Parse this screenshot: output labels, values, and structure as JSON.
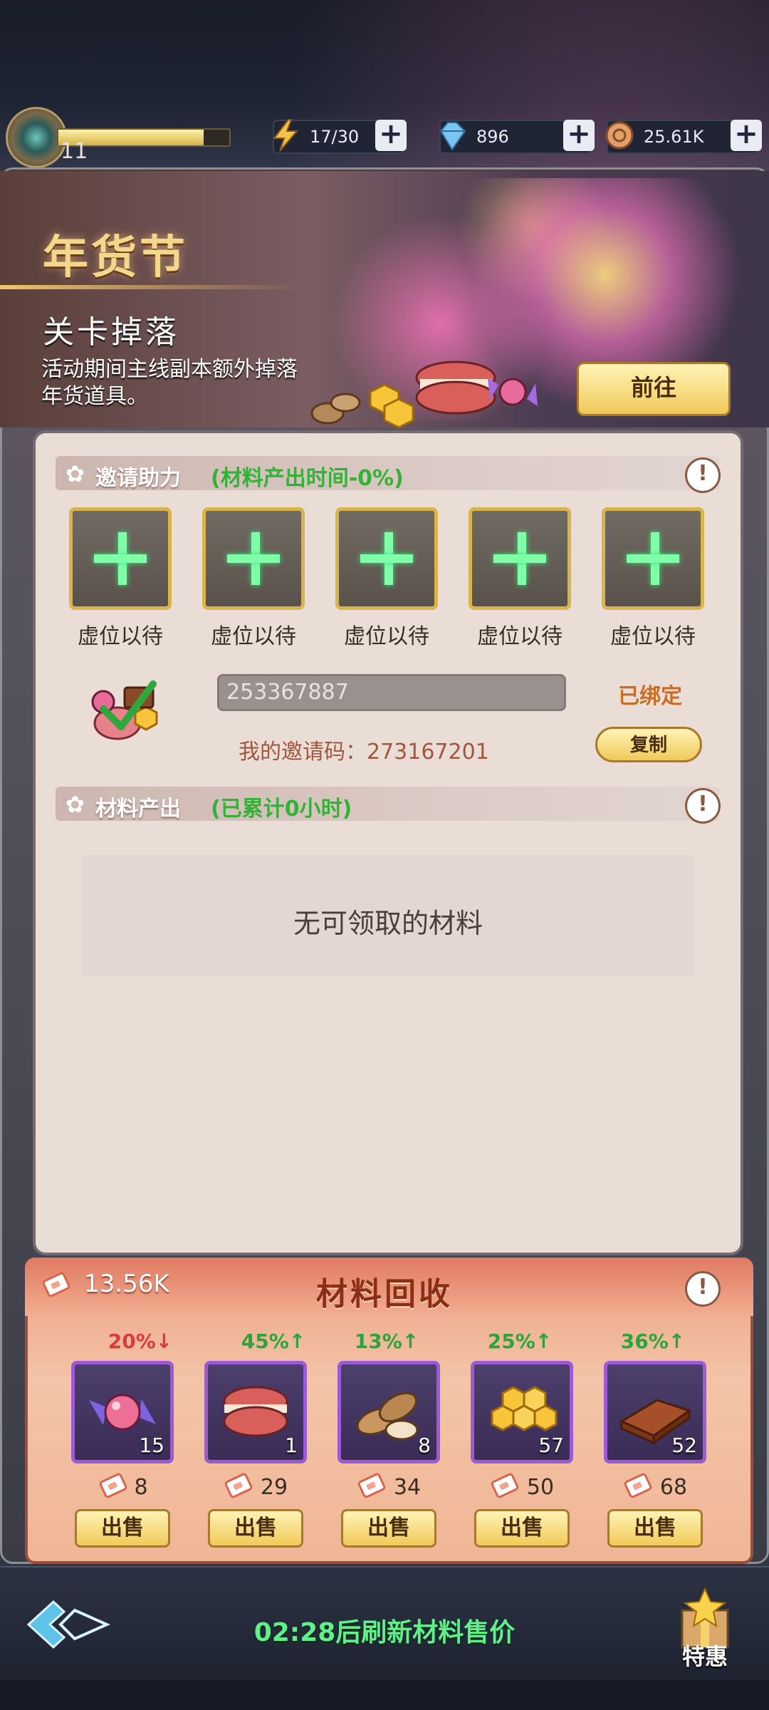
{
  "player": {
    "level": "11",
    "xp_fraction": 0.85
  },
  "resources": [
    {
      "icon": "lightning-icon",
      "value": "17/30"
    },
    {
      "icon": "diamond-icon",
      "value": "896"
    },
    {
      "icon": "coin-icon",
      "value": "25.61K"
    }
  ],
  "banner": {
    "title": "年货节",
    "subtitle": "关卡掉落",
    "description": "活动期间主线副本额外掉落年货道具。",
    "goto_label": "前往"
  },
  "invite": {
    "header": "邀请助力",
    "note": "(材料产出时间-0%)",
    "slot_label": "虚位以待",
    "slots": [
      "虚位以待",
      "虚位以待",
      "虚位以待",
      "虚位以待",
      "虚位以待"
    ],
    "code_value": "253367887",
    "bound_label": "已绑定",
    "my_code_label": "我的邀请码：273167201",
    "copy_label": "复制"
  },
  "output": {
    "header": "材料产出",
    "note": "(已累计0小时)",
    "empty_text": "无可领取的材料"
  },
  "recycle": {
    "title": "材料回收",
    "coupons": "13.56K",
    "sell_label": "出售",
    "items": [
      {
        "name": "candy",
        "icon": "candy-icon",
        "change": "20%↓",
        "direction": "down",
        "count": "15",
        "price": "8"
      },
      {
        "name": "macaron",
        "icon": "macaron-icon",
        "change": "45%↑",
        "direction": "up",
        "count": "1",
        "price": "29"
      },
      {
        "name": "almond",
        "icon": "almond-icon",
        "change": "13%↑",
        "direction": "up",
        "count": "8",
        "price": "34"
      },
      {
        "name": "honeycomb",
        "icon": "honeycomb-icon",
        "change": "25%↑",
        "direction": "up",
        "count": "57",
        "price": "50"
      },
      {
        "name": "chocolate",
        "icon": "chocolate-icon",
        "change": "36%↑",
        "direction": "up",
        "count": "52",
        "price": "68"
      }
    ]
  },
  "footer": {
    "refresh_text": "02:28后刷新材料售价",
    "gift_label": "特惠"
  },
  "colors": {
    "accent_green": "#5ff08a",
    "up": "#2aa53c",
    "down": "#d93c3c",
    "gold": "#f1c95a"
  }
}
